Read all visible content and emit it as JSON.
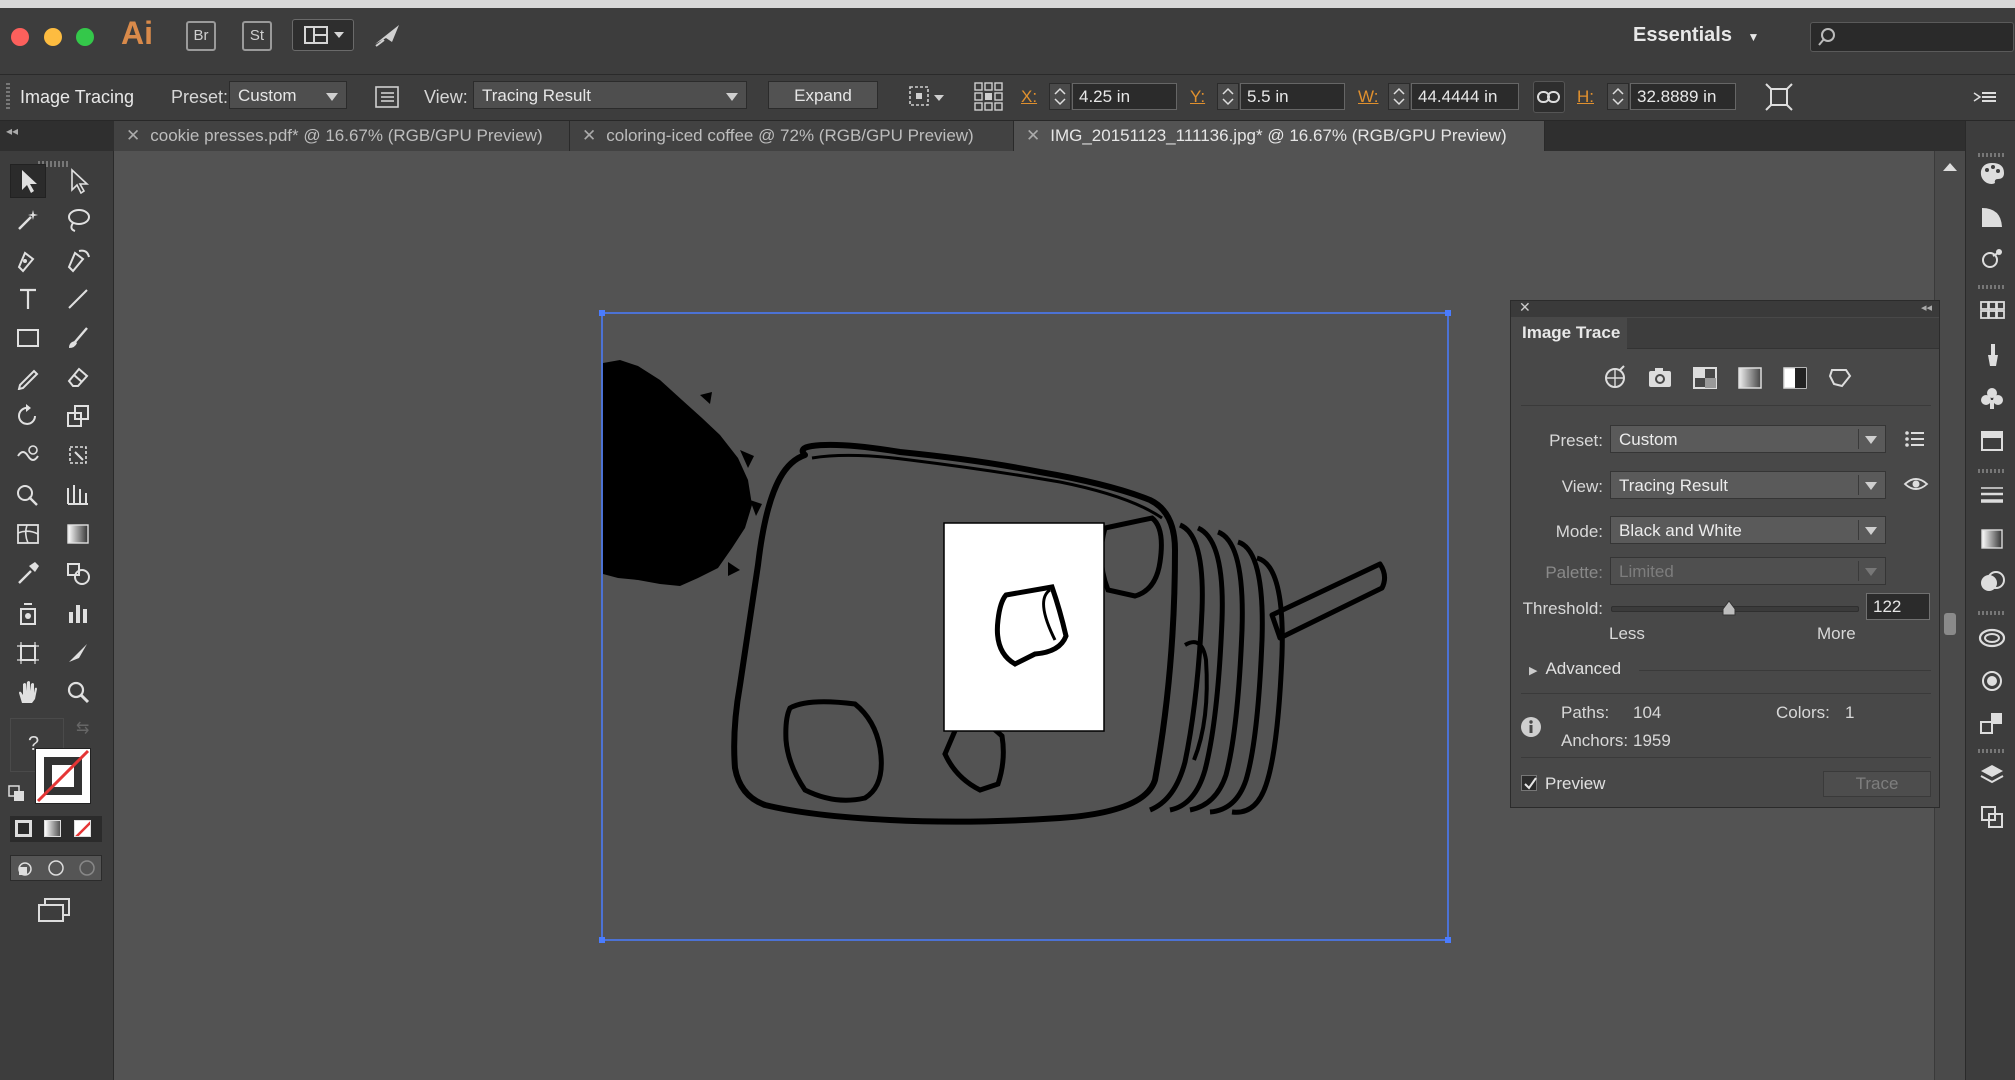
{
  "app": {
    "logo": "Ai",
    "bridge_label": "Br",
    "stock_label": "St",
    "workspace": "Essentials"
  },
  "control_bar": {
    "context_label": "Image Tracing",
    "preset_label": "Preset:",
    "preset_value": "Custom",
    "view_label": "View:",
    "view_value": "Tracing Result",
    "expand_label": "Expand",
    "x_label": "X:",
    "x_value": "4.25 in",
    "y_label": "Y:",
    "y_value": "5.5 in",
    "w_label": "W:",
    "w_value": "44.4444 in",
    "h_label": "H:",
    "h_value": "32.8889 in"
  },
  "tabs": [
    {
      "close": "✕",
      "label": "cookie presses.pdf* @ 16.67% (RGB/GPU Preview)"
    },
    {
      "close": "✕",
      "label": "coloring-iced coffee @ 72% (RGB/GPU Preview)"
    },
    {
      "close": "✕",
      "label": "IMG_20151123_111136.jpg* @ 16.67% (RGB/GPU Preview)"
    }
  ],
  "toolbar": {
    "unknown_glyph": "?"
  },
  "image_trace_panel": {
    "close": "✕",
    "title": "Image Trace",
    "preset_label": "Preset:",
    "preset_value": "Custom",
    "view_label": "View:",
    "view_value": "Tracing Result",
    "mode_label": "Mode:",
    "mode_value": "Black and White",
    "palette_label": "Palette:",
    "palette_value": "Limited",
    "threshold_label": "Threshold:",
    "threshold_value": "122",
    "threshold_level": 0.48,
    "less_label": "Less",
    "more_label": "More",
    "advanced_label": "Advanced",
    "paths_label": "Paths:",
    "paths_value": "104",
    "colors_label": "Colors:",
    "colors_value": "1",
    "anchors_label": "Anchors:",
    "anchors_value": "1959",
    "preview_label": "Preview",
    "preview_checked": true,
    "trace_label": "Trace"
  },
  "colors": {
    "accent_orange": "#e0902e",
    "selection_blue": "#4a7cff",
    "close_red": "#fc605c",
    "min_yellow": "#fdbc40",
    "max_green": "#34c84a"
  }
}
